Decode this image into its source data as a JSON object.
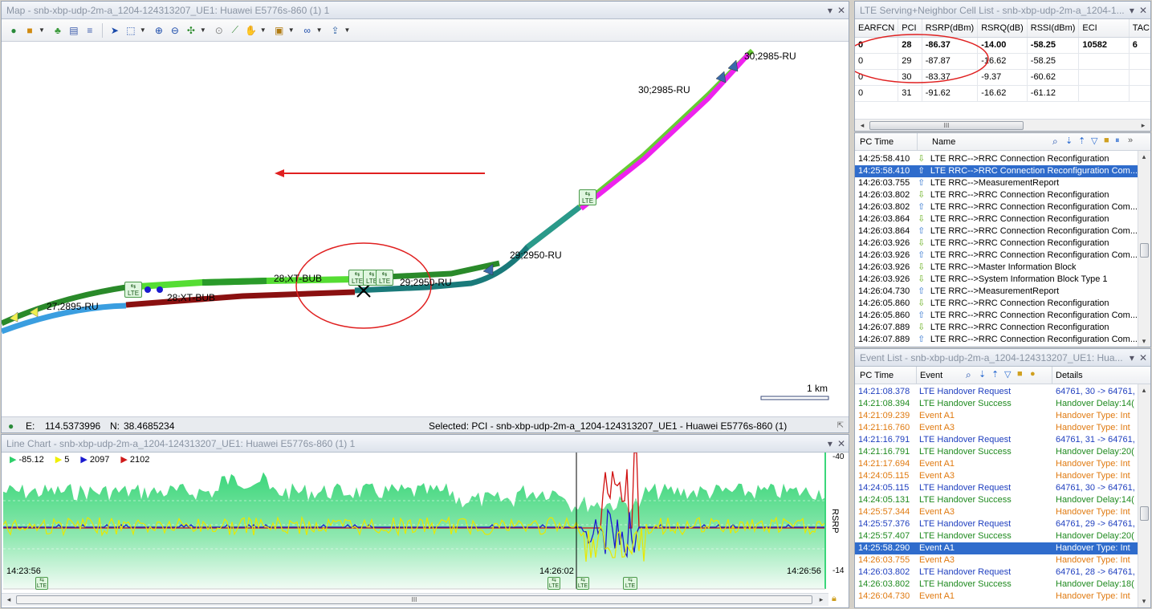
{
  "map": {
    "title": "Map - snb-xbp-udp-2m-a_1204-124313207_UE1: Huawei E5776s-860 (1) 1",
    "labels": {
      "l1": "30;2985-RU",
      "l2": "30;2985-RU",
      "l3": "29;2950-RU",
      "l4": "28;XT-BUB",
      "l5": "29;2950-RU",
      "l6": "28;XT-BUB",
      "l7": "27;2895-RU"
    },
    "lte_tag": "LTE",
    "scale": "1 km",
    "coords": {
      "e_label": "E:",
      "e_value": "114.5373996",
      "n_label": "N:",
      "n_value": "38.4685234"
    },
    "selected": "Selected: PCI - snb-xbp-udp-2m-a_1204-124313207_UE1 - Huawei E5776s-860 (1)"
  },
  "cell_list": {
    "title": "LTE Serving+Neighbor Cell List - snb-xbp-udp-2m-a_1204-1...",
    "columns": [
      "EARFCN",
      "PCI",
      "RSRP(dBm)",
      "RSRQ(dB)",
      "RSSI(dBm)",
      "ECI",
      "TAC"
    ],
    "rows": [
      [
        "0",
        "28",
        "-86.37",
        "-14.00",
        "-58.25",
        "10582",
        "6"
      ],
      [
        "0",
        "29",
        "-87.87",
        "-16.62",
        "-58.25",
        "",
        ""
      ],
      [
        "0",
        "30",
        "-83.37",
        "-9.37",
        "-60.62",
        "",
        ""
      ],
      [
        "0",
        "31",
        "-91.62",
        "-16.62",
        "-61.12",
        "",
        ""
      ]
    ],
    "scroll_mark": "III"
  },
  "messages": {
    "col_time": "PC Time",
    "col_name": "Name",
    "rows": [
      {
        "time": "14:25:58.410",
        "dir": "down",
        "name": "LTE RRC-->RRC Connection Reconfiguration"
      },
      {
        "time": "14:25:58.410",
        "dir": "up",
        "name": "LTE RRC-->RRC Connection Reconfiguration Com..."
      },
      {
        "time": "14:26:03.755",
        "dir": "up",
        "name": "LTE RRC-->MeasurementReport"
      },
      {
        "time": "14:26:03.802",
        "dir": "down",
        "name": "LTE RRC-->RRC Connection Reconfiguration"
      },
      {
        "time": "14:26:03.802",
        "dir": "up",
        "name": "LTE RRC-->RRC Connection Reconfiguration Com..."
      },
      {
        "time": "14:26:03.864",
        "dir": "down",
        "name": "LTE RRC-->RRC Connection Reconfiguration"
      },
      {
        "time": "14:26:03.864",
        "dir": "up",
        "name": "LTE RRC-->RRC Connection Reconfiguration Com..."
      },
      {
        "time": "14:26:03.926",
        "dir": "down",
        "name": "LTE RRC-->RRC Connection Reconfiguration"
      },
      {
        "time": "14:26:03.926",
        "dir": "up",
        "name": "LTE RRC-->RRC Connection Reconfiguration Com..."
      },
      {
        "time": "14:26:03.926",
        "dir": "down",
        "name": "LTE RRC-->Master Information Block"
      },
      {
        "time": "14:26:03.926",
        "dir": "down",
        "name": "LTE RRC-->System Information Block Type 1"
      },
      {
        "time": "14:26:04.730",
        "dir": "up",
        "name": "LTE RRC-->MeasurementReport"
      },
      {
        "time": "14:26:05.860",
        "dir": "down",
        "name": "LTE RRC-->RRC Connection Reconfiguration"
      },
      {
        "time": "14:26:05.860",
        "dir": "up",
        "name": "LTE RRC-->RRC Connection Reconfiguration Com..."
      },
      {
        "time": "14:26:07.889",
        "dir": "down",
        "name": "LTE RRC-->RRC Connection Reconfiguration"
      },
      {
        "time": "14:26:07.889",
        "dir": "up",
        "name": "LTE RRC-->RRC Connection Reconfiguration Com..."
      }
    ]
  },
  "events": {
    "title": "Event List - snb-xbp-udp-2m-a_1204-124313207_UE1: Hua...",
    "col_time": "PC Time",
    "col_event": "Event",
    "col_details": "Details",
    "rows": [
      {
        "time": "14:21:08.378",
        "event": "LTE Handover Request",
        "details": "64761, 30 -> 64761,",
        "color": "blue"
      },
      {
        "time": "14:21:08.394",
        "event": "LTE Handover Success",
        "details": "Handover Delay:14(",
        "color": "green"
      },
      {
        "time": "14:21:09.239",
        "event": "Event A1",
        "details": "Handover Type: Int",
        "color": "orange"
      },
      {
        "time": "14:21:16.760",
        "event": "Event A3",
        "details": "Handover Type: Int",
        "color": "orange"
      },
      {
        "time": "14:21:16.791",
        "event": "LTE Handover Request",
        "details": "64761, 31 -> 64761,",
        "color": "blue"
      },
      {
        "time": "14:21:16.791",
        "event": "LTE Handover Success",
        "details": "Handover Delay:20(",
        "color": "green"
      },
      {
        "time": "14:21:17.694",
        "event": "Event A1",
        "details": "Handover Type: Int",
        "color": "orange"
      },
      {
        "time": "14:24:05.115",
        "event": "Event A3",
        "details": "Handover Type: Int",
        "color": "orange"
      },
      {
        "time": "14:24:05.115",
        "event": "LTE Handover Request",
        "details": "64761, 30 -> 64761,",
        "color": "blue"
      },
      {
        "time": "14:24:05.131",
        "event": "LTE Handover Success",
        "details": "Handover Delay:14(",
        "color": "green"
      },
      {
        "time": "14:25:57.344",
        "event": "Event A3",
        "details": "Handover Type: Int",
        "color": "orange"
      },
      {
        "time": "14:25:57.376",
        "event": "LTE Handover Request",
        "details": "64761, 29 -> 64761,",
        "color": "blue"
      },
      {
        "time": "14:25:57.407",
        "event": "LTE Handover Success",
        "details": "Handover Delay:20(",
        "color": "green"
      },
      {
        "time": "14:25:58.290",
        "event": "Event A1",
        "details": "Handover Type: Int",
        "color": "orange",
        "selected": true
      },
      {
        "time": "14:26:03.755",
        "event": "Event A3",
        "details": "Handover Type: Int",
        "color": "orange"
      },
      {
        "time": "14:26:03.802",
        "event": "LTE Handover Request",
        "details": "64761, 28 -> 64761,",
        "color": "blue"
      },
      {
        "time": "14:26:03.802",
        "event": "LTE Handover Success",
        "details": "Handover Delay:18(",
        "color": "green"
      },
      {
        "time": "14:26:04.730",
        "event": "Event A1",
        "details": "Handover Type: Int",
        "color": "orange"
      }
    ]
  },
  "line_chart": {
    "title": "Line Chart - snb-xbp-udp-2m-a_1204-124313207_UE1: Huawei E5776s-860 (1) 1",
    "legend": [
      {
        "value": "-85.12",
        "color": "#2ecf6a"
      },
      {
        "value": "5",
        "color": "#f0f000"
      },
      {
        "value": "2097",
        "color": "#1a1acf"
      },
      {
        "value": "2102",
        "color": "#cf1a1a"
      }
    ],
    "y_top": "-40",
    "y_bottom": "-14",
    "y_label": "RSRP",
    "t_start": "14:23:56",
    "t_mid": "14:26:02",
    "t_end": "14:26:56",
    "scroll_mark": "III"
  },
  "colors": {
    "selection": "#2f6ccc",
    "annotation": "#e02020"
  }
}
